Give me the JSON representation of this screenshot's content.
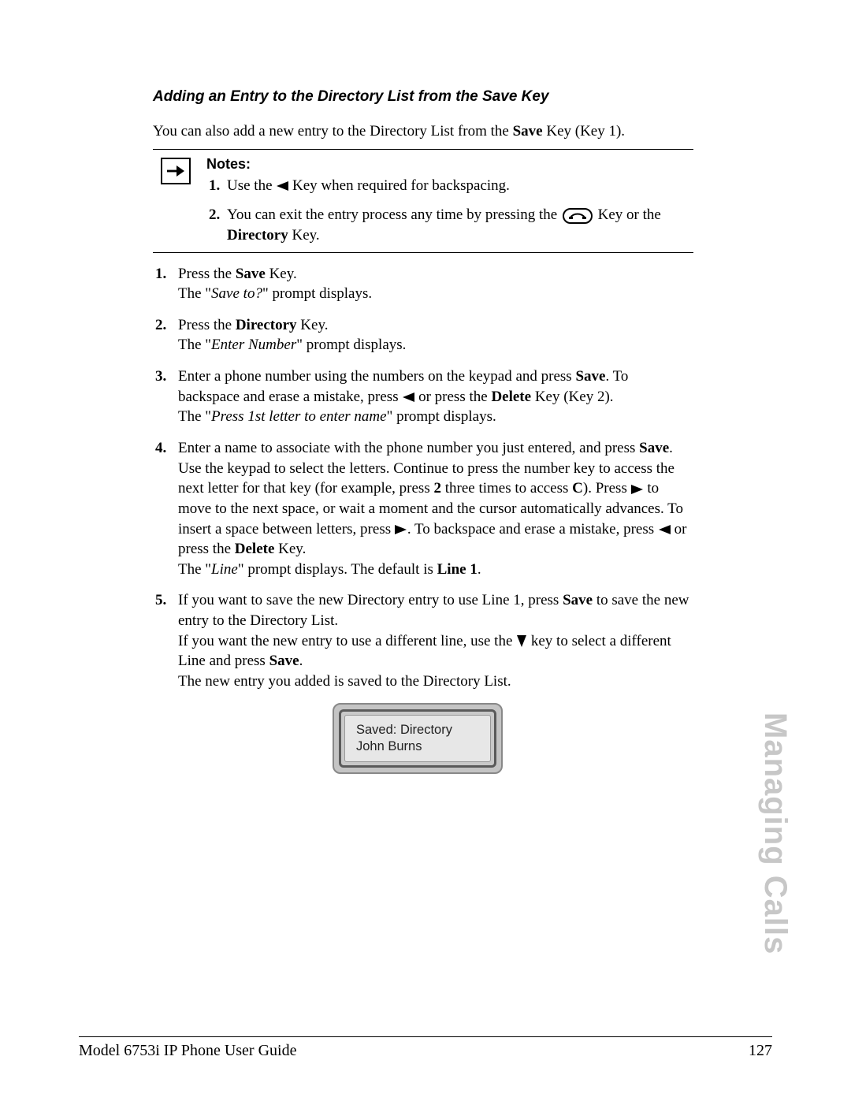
{
  "heading": "Adding an Entry to the Directory List from the Save Key",
  "intro": {
    "pre": "You can also add a new entry to the Directory List from the ",
    "bold1": "Save",
    "post": " Key (Key 1)."
  },
  "notes": {
    "title": "Notes:",
    "n1": {
      "pre": "Use the ",
      "post": " Key when required for backspacing."
    },
    "n2": {
      "pre": "You can exit the entry process any time by pressing the ",
      "mid": " Key or the ",
      "bold": "Directory",
      "post": " Key."
    }
  },
  "steps": {
    "s1": {
      "a": "Press the ",
      "b": "Save",
      "c": " Key.",
      "line2a": "The \"",
      "line2i": "Save to?",
      "line2c": "\" prompt displays."
    },
    "s2": {
      "a": "Press the ",
      "b": "Directory",
      "c": " Key.",
      "line2a": "The \"",
      "line2i": "Enter Number",
      "line2c": "\" prompt displays."
    },
    "s3": {
      "a": "Enter a phone number using the numbers on the keypad and press ",
      "b": "Save",
      "c": ". To backspace and erase a mistake, press ",
      "d": " or press the ",
      "e": "Delete",
      "f": " Key (Key 2).",
      "line2a": "The \"",
      "line2i": "Press 1st letter to enter name",
      "line2c": "\" prompt displays."
    },
    "s4": {
      "a": "Enter a name to associate with the phone number you just entered, and press ",
      "b": "Save",
      "c": ". Use the keypad to select the letters. Continue to press the number key to access the next letter for that key (for example, press ",
      "d": "2",
      "e": " three times to access ",
      "f": "C",
      "g": "). Press ",
      "h": " to move to the next space, or wait a moment and the cursor automatically advances. To insert a space between letters, press ",
      "i": ". To backspace and erase a mistake, press ",
      "j": " or press the ",
      "k": "Delete",
      "l": " Key.",
      "line2a": "The \"",
      "line2i": "Line",
      "line2c": "\" prompt displays. The default is ",
      "line2d": "Line 1",
      "line2e": "."
    },
    "s5": {
      "a": "If you want to save the new Directory entry to use Line 1, press ",
      "b": "Save",
      "c": " to save the new entry to the Directory List.",
      "d": "If you want the new entry to use a different line, use the ",
      "e": " key to select a different Line and press ",
      "f": "Save",
      "g": ".",
      "h": "The new entry you added is saved to the Directory List."
    }
  },
  "lcd": {
    "line1": "Saved: Directory",
    "line2": "John Burns"
  },
  "side_tab": "Managing Calls",
  "footer": {
    "left": "Model 6753i IP Phone User Guide",
    "page": "127"
  }
}
